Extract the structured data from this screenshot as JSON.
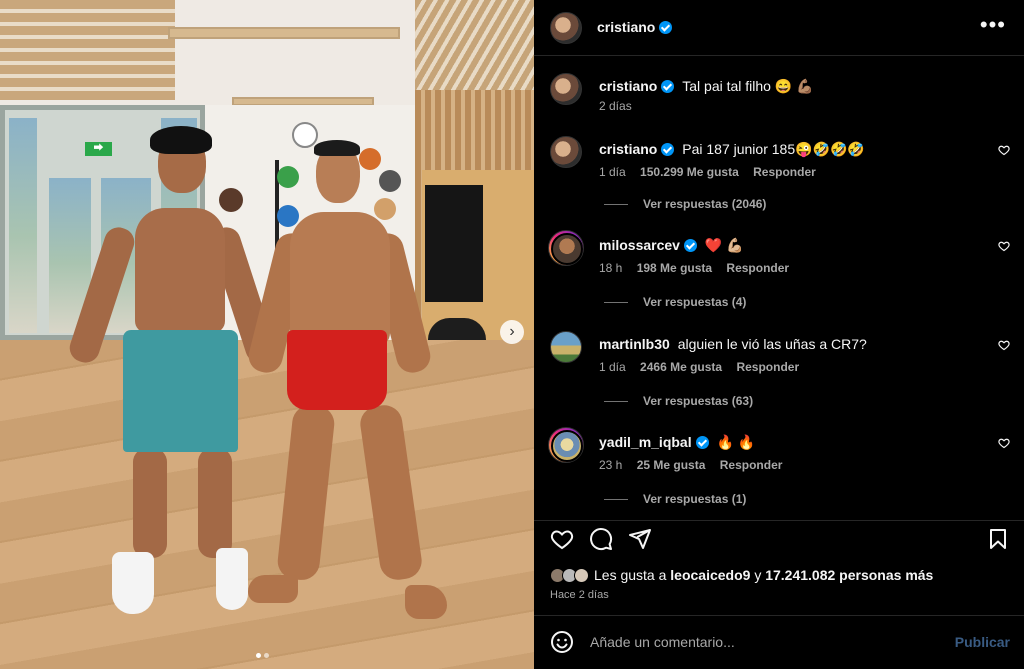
{
  "post": {
    "author": "cristiano",
    "more_icon": "more-options-icon",
    "caption": {
      "username": "cristiano",
      "text": "Tal pai tal filho 😄 💪🏽",
      "time": "2 días"
    },
    "carousel": {
      "total_slides": 2,
      "active_slide": 1
    }
  },
  "comments": [
    {
      "username": "cristiano",
      "verified": true,
      "text": "Pai 187 junior 185😜🤣🤣🤣",
      "time": "1 día",
      "likes": "150.299 Me gusta",
      "reply": "Responder",
      "view_replies": "Ver respuestas (2046)"
    },
    {
      "username": "milossarcev",
      "verified": true,
      "text": "❤️ 💪🏼",
      "time": "18 h",
      "likes": "198 Me gusta",
      "reply": "Responder",
      "view_replies": "Ver respuestas (4)"
    },
    {
      "username": "martinlb30",
      "verified": false,
      "text": "alguien le vió las uñas a CR7?",
      "time": "1 día",
      "likes": "2466 Me gusta",
      "reply": "Responder",
      "view_replies": "Ver respuestas (63)"
    },
    {
      "username": "yadil_m_iqbal",
      "verified": true,
      "text": "🔥 🔥",
      "time": "23 h",
      "likes": "25 Me gusta",
      "reply": "Responder",
      "view_replies": "Ver respuestas (1)"
    }
  ],
  "likes_summary": {
    "prefix": "Les gusta a",
    "user": "leocaicedo9",
    "connector": "y",
    "count": "17.241.082 personas más"
  },
  "posted_ago": "Hace 2 días",
  "comment_box": {
    "placeholder": "Añade un comentario...",
    "publish_label": "Publicar"
  },
  "icons": {
    "like": "heart-icon",
    "comment": "comment-bubble-icon",
    "share": "paper-plane-icon",
    "save": "bookmark-icon",
    "emoji": "emoji-icon",
    "next": "chevron-right-icon"
  },
  "colors": {
    "background": "#000000",
    "text": "#f5f5f5",
    "secondary_text": "#a8a8a8",
    "verified_blue": "#0095f6",
    "publish_disabled": "#395b83"
  }
}
